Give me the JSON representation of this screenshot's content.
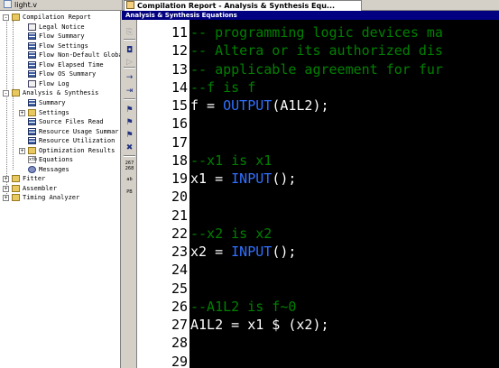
{
  "tabs": [
    {
      "label": "light.v",
      "active": false
    },
    {
      "label": "Compilation Report - Analysis & Synthesis Equ...",
      "active": true
    }
  ],
  "tree": {
    "items": [
      {
        "label": "Compilation Report",
        "icon": "folder-icon",
        "expander": "-"
      },
      {
        "label": "Legal Notice",
        "icon": "report-icon",
        "expander": ""
      },
      {
        "label": "Flow Summary",
        "icon": "table-icon",
        "expander": ""
      },
      {
        "label": "Flow Settings",
        "icon": "table-icon",
        "expander": ""
      },
      {
        "label": "Flow Non-Default Global",
        "icon": "table-icon",
        "expander": ""
      },
      {
        "label": "Flow Elapsed Time",
        "icon": "table-icon",
        "expander": ""
      },
      {
        "label": "Flow OS Summary",
        "icon": "table-icon",
        "expander": ""
      },
      {
        "label": "Flow Log",
        "icon": "report-icon",
        "expander": ""
      },
      {
        "label": "Analysis & Synthesis",
        "icon": "folder-icon",
        "expander": "-"
      },
      {
        "label": "Summary",
        "icon": "table-icon",
        "expander": ""
      },
      {
        "label": "Settings",
        "icon": "folder-icon",
        "expander": "+"
      },
      {
        "label": "Source Files Read",
        "icon": "table-icon",
        "expander": ""
      },
      {
        "label": "Resource Usage Summar",
        "icon": "table-icon",
        "expander": ""
      },
      {
        "label": "Resource Utilization",
        "icon": "table-icon",
        "expander": ""
      },
      {
        "label": "Optimization Results",
        "icon": "folder-icon",
        "expander": "+"
      },
      {
        "label": "Equations",
        "icon": "equations-icon",
        "expander": "",
        "selected": true
      },
      {
        "label": "Messages",
        "icon": "messages-icon",
        "expander": ""
      },
      {
        "label": "Fitter",
        "icon": "folder-icon",
        "expander": "+"
      },
      {
        "label": "Assembler",
        "icon": "folder-icon",
        "expander": "+"
      },
      {
        "label": "Timing Analyzer",
        "icon": "folder-icon",
        "expander": "+"
      }
    ]
  },
  "toolbar": {
    "icons": [
      "copy-icon",
      "find-icon",
      "find-next-icon",
      "goto-line-icon",
      "indent-icon",
      "bookmark-toggle-icon",
      "bookmark-next-icon",
      "bookmark-prev-icon",
      "bookmark-clear-icon",
      "line-numbers-icon",
      "word-wrap-icon",
      "preferences-icon"
    ],
    "line_numbers_label": "267\n268",
    "wrap_label": "ab",
    "pref_label": "PB"
  },
  "document": {
    "title": "Analysis & Synthesis Equations",
    "lines": [
      {
        "n": "11",
        "text": "-- programming logic devices ma",
        "type": "comment"
      },
      {
        "n": "12",
        "text": "-- Altera or its authorized dis",
        "type": "comment"
      },
      {
        "n": "13",
        "text": "-- applicable agreement for fur",
        "type": "comment"
      },
      {
        "n": "14",
        "text": "--f is f",
        "type": "comment"
      },
      {
        "n": "15",
        "pre": "f = ",
        "kw": "OUTPUT",
        "post": "(A1L2);",
        "type": "code"
      },
      {
        "n": "16",
        "text": "",
        "type": "code"
      },
      {
        "n": "17",
        "text": "",
        "type": "code"
      },
      {
        "n": "18",
        "text": "--x1 is x1",
        "type": "comment"
      },
      {
        "n": "19",
        "pre": "x1 = ",
        "kw": "INPUT",
        "post": "();",
        "type": "code"
      },
      {
        "n": "20",
        "text": "",
        "type": "code"
      },
      {
        "n": "21",
        "text": "",
        "type": "code"
      },
      {
        "n": "22",
        "text": "--x2 is x2",
        "type": "comment"
      },
      {
        "n": "23",
        "pre": "x2 = ",
        "kw": "INPUT",
        "post": "();",
        "type": "code"
      },
      {
        "n": "24",
        "text": "",
        "type": "code"
      },
      {
        "n": "25",
        "text": "",
        "type": "code"
      },
      {
        "n": "26",
        "text": "--A1L2 is f~0",
        "type": "comment"
      },
      {
        "n": "27",
        "text": "A1L2 = x1 $ (x2);",
        "type": "code"
      },
      {
        "n": "28",
        "text": "",
        "type": "code"
      },
      {
        "n": "29",
        "text": "",
        "type": "code"
      }
    ]
  },
  "colors": {
    "code_bg": "#000000",
    "comment": "#008000",
    "keyword": "#3070ff",
    "code_text": "#ffffff",
    "header_bg": "#000080"
  }
}
